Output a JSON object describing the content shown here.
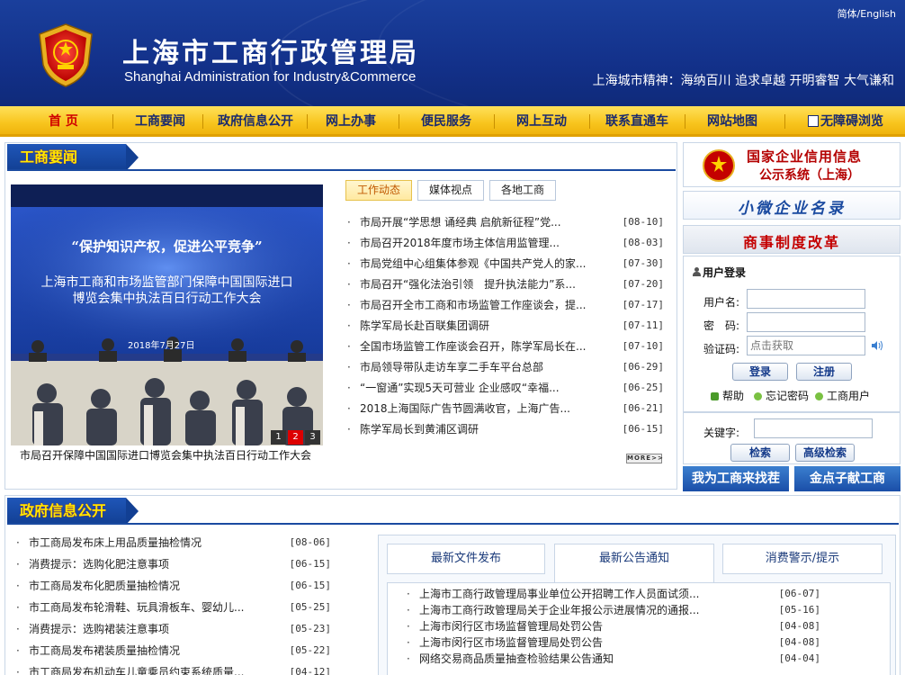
{
  "header": {
    "title": "上海市工商行政管理局",
    "subtitle": "Shanghai Administration for Industry&Commerce",
    "lang_links": "简体/English",
    "slogan": "上海城市精神：海纳百川 追求卓越 开明睿智 大气谦和"
  },
  "nav": {
    "items": [
      "首 页",
      "工商要闻",
      "政府信息公开",
      "网上办事",
      "便民服务",
      "网上互动",
      "联系直通车",
      "网站地图",
      "无障碍浏览"
    ]
  },
  "news": {
    "section_title": "工商要闻",
    "photo": {
      "banner_slogan": "“保护知识产权，促进公平竞争”",
      "banner_line1": "上海市工商和市场监管部门保障中国国际进口",
      "banner_line2": "博览会集中执法百日行动工作大会",
      "banner_date": "2018年7月27日",
      "caption": "市局召开保障中国国际进口博览会集中执法百日行动工作大会",
      "slides": [
        "1",
        "2",
        "3"
      ],
      "active_slide": 2
    },
    "tabs": [
      "工作动态",
      "媒体视点",
      "各地工商"
    ],
    "active_tab": 0,
    "items": [
      {
        "title": "市局开展“学思想 诵经典 启航新征程”党...",
        "date": "[08-10]"
      },
      {
        "title": "市局召开2018年度市场主体信用监管理...",
        "date": "[08-03]"
      },
      {
        "title": "市局党组中心组集体参观《中国共产党人的家...",
        "date": "[07-30]"
      },
      {
        "title": "市局召开“强化法治引领　提升执法能力”系...",
        "date": "[07-20]"
      },
      {
        "title": "市局召开全市工商和市场监管工作座谈会，提...",
        "date": "[07-17]"
      },
      {
        "title": "陈学军局长赴百联集团调研",
        "date": "[07-11]"
      },
      {
        "title": "全国市场监管工作座谈会召开，陈学军局长在...",
        "date": "[07-10]"
      },
      {
        "title": "市局领导带队走访车享二手车平台总部",
        "date": "[06-29]"
      },
      {
        "title": "“一窗通”实现5天可营业 企业感叹“幸福...",
        "date": "[06-25]"
      },
      {
        "title": "2018上海国际广告节圆满收官，上海广告...",
        "date": "[06-21]"
      },
      {
        "title": "陈学军局长到黄浦区调研",
        "date": "[06-15]"
      }
    ],
    "more_label": "MORE>>"
  },
  "sidebar": {
    "credit_banner_line1": "国家企业信用信息",
    "credit_banner_line2": "公示系统（上海）",
    "micro_banner": "小微企业名录",
    "reform_banner": "商事制度改革",
    "login": {
      "title": "用户登录",
      "username_label": "用户名:",
      "password_label": "密　码:",
      "captcha_label": "验证码:",
      "captcha_placeholder": "点击获取",
      "login_button": "登录",
      "register_button": "注册",
      "help_link": "帮助",
      "forgot_link": "忘记密码",
      "user_link": "工商用户"
    },
    "search": {
      "keyword_label": "关键字:",
      "search_button": "检索",
      "advanced_button": "高级检索"
    },
    "bottom_banners": [
      "我为工商来找茬",
      "金点子献工商"
    ]
  },
  "gov_info": {
    "section_title": "政府信息公开",
    "items": [
      {
        "title": "市工商局发布床上用品质量抽检情况",
        "date": "[08-06]"
      },
      {
        "title": "消费提示：选购化肥注意事项",
        "date": "[06-15]"
      },
      {
        "title": "市工商局发布化肥质量抽检情况",
        "date": "[06-15]"
      },
      {
        "title": "市工商局发布轮滑鞋、玩具滑板车、婴幼儿...",
        "date": "[05-25]"
      },
      {
        "title": "消费提示：选购裙装注意事项",
        "date": "[05-23]"
      },
      {
        "title": "市工商局发布裙装质量抽检情况",
        "date": "[05-22]"
      },
      {
        "title": "市工商局发布机动车儿童乘员约束系统质量...",
        "date": "[04-12]"
      }
    ]
  },
  "docs": {
    "tabs": [
      "最新文件发布",
      "最新公告通知",
      "消费警示/提示"
    ],
    "active_tab": 1,
    "items": [
      {
        "title": "上海市工商行政管理局事业单位公开招聘工作人员面试须...",
        "date": "[06-07]"
      },
      {
        "title": "上海市工商行政管理局关于企业年报公示进展情况的通报...",
        "date": "[05-16]"
      },
      {
        "title": "上海市闵行区市场监督管理局处罚公告",
        "date": "[04-08]"
      },
      {
        "title": "上海市闵行区市场监督管理局处罚公告",
        "date": "[04-08]"
      },
      {
        "title": "网络交易商品质量抽查检验结果公告通知",
        "date": "[04-04]"
      }
    ]
  },
  "colors": {
    "header_blue": "#13318a",
    "nav_yellow": "#f8c51e",
    "accent_red": "#d00000",
    "title_blue": "#1a4aa0"
  }
}
